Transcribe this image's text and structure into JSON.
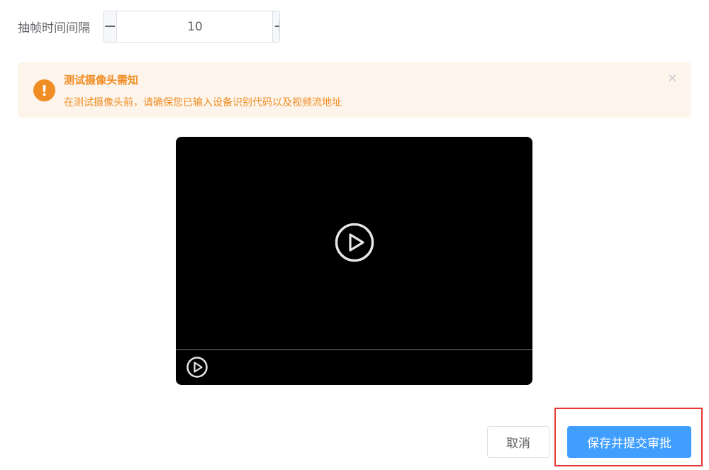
{
  "form": {
    "frame_interval_label": "抽帧时间间隔",
    "frame_interval_value": "10",
    "minus_symbol": "−",
    "plus_symbol": "+"
  },
  "alert": {
    "icon_symbol": "!",
    "title": "测试摄像头需知",
    "description": "在测试摄像头前，请确保您已输入设备识别代码以及视频流地址",
    "close_symbol": "×",
    "color": "#f08d24",
    "background": "#fdf5ec"
  },
  "video": {
    "center_icon": "play-circle-icon",
    "control_icon": "play-circle-icon"
  },
  "footer": {
    "cancel_label": "取消",
    "submit_label": "保存并提交审批",
    "primary_color": "#409eff",
    "highlight_color": "#e53935"
  }
}
